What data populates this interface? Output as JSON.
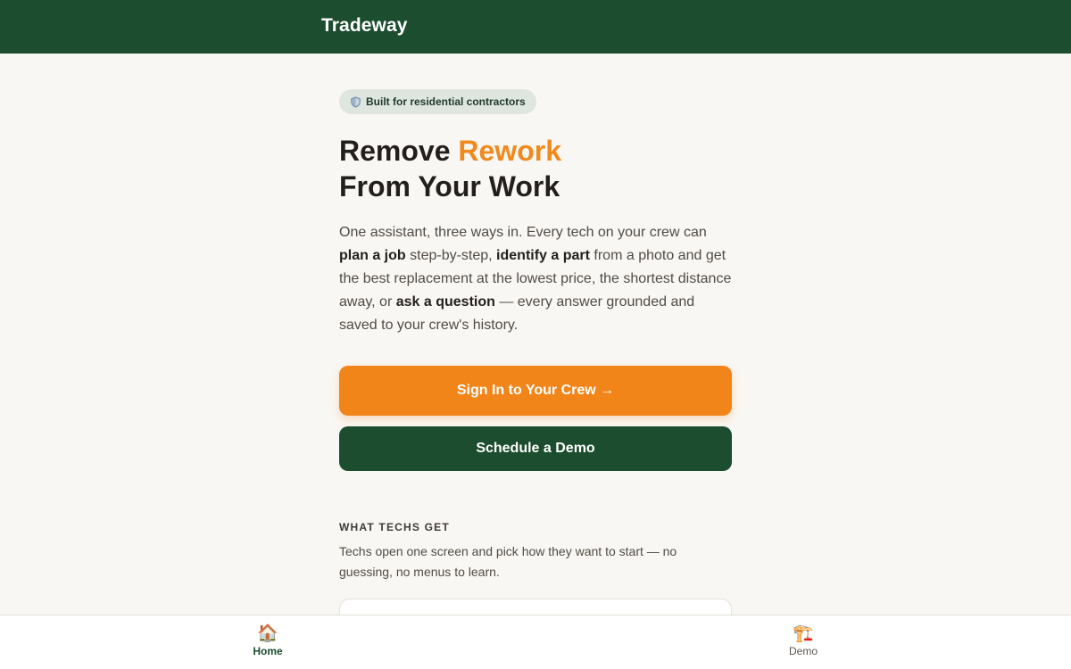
{
  "header": {
    "brand": "Tradeway"
  },
  "hero": {
    "badge": {
      "icon": "shield-icon",
      "label": "Built for residential contractors"
    },
    "headline": {
      "part1": "Remove ",
      "accent": "Rework",
      "line2": "From Your Work"
    },
    "lead": {
      "t1": "One assistant, three ways in. Every tech on your crew can ",
      "b1": "plan a job",
      "t2": " step-by-step, ",
      "b2": "identify a part",
      "t3": " from a photo and get the best replacement at the lowest price, the shortest distance away, or ",
      "b3": "ask a question",
      "t4": " — every answer grounded and saved to your crew's history."
    },
    "primary_button": "Sign In to Your Crew →",
    "secondary_button": "Schedule a Demo"
  },
  "section": {
    "label": "WHAT TECHS GET",
    "description": "Techs open one screen and pick how they want to start — no guessing, no menus to learn."
  },
  "bottom_nav": {
    "items": [
      {
        "icon": "🏠",
        "label": "Home",
        "active": true
      },
      {
        "icon": "🏗️",
        "label": "Demo",
        "active": false
      }
    ]
  },
  "colors": {
    "brand_green": "#1b4d2e",
    "accent_orange": "#f28519",
    "background": "#f9f7f3"
  }
}
